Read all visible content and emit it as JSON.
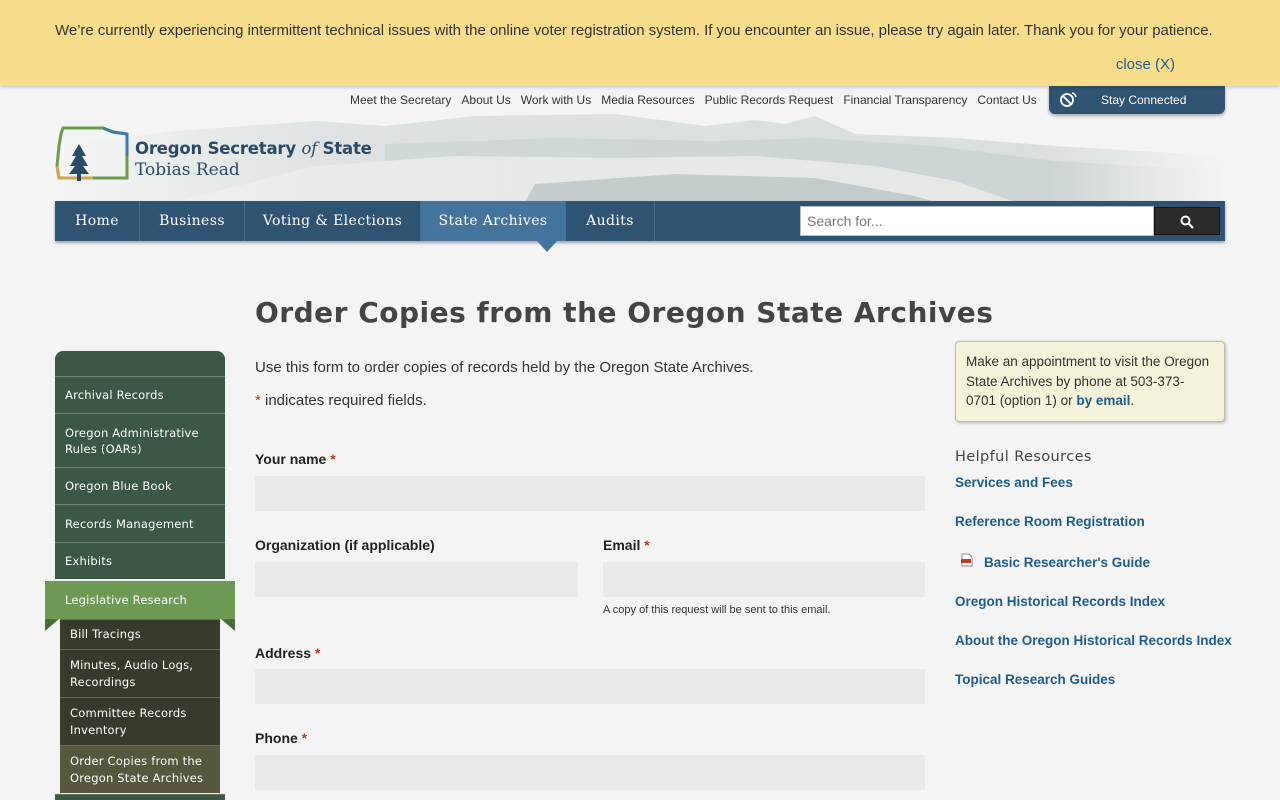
{
  "alert": {
    "message": "We’re currently experiencing intermittent technical issues with the online voter registration system. If you encounter an issue, please try again later. Thank you for your patience.",
    "close_label": "close (X)"
  },
  "utility_nav": [
    "Meet the Secretary",
    "About Us",
    "Work with Us",
    "Media Resources",
    "Public Records Request",
    "Financial Transparency",
    "Contact Us"
  ],
  "stay_connected": "Stay Connected",
  "logo": {
    "title_part1": "Oregon Secretary ",
    "title_of": "of",
    "title_part2": " State",
    "subtitle": "Tobias Read"
  },
  "main_nav": {
    "items": [
      "Home",
      "Business",
      "Voting & Elections",
      "State Archives",
      "Audits"
    ],
    "active": "State Archives"
  },
  "search": {
    "placeholder": "Search for..."
  },
  "sidebar": {
    "items": [
      "Archival Records",
      "Oregon Administrative Rules (OARs)",
      "Oregon Blue Book",
      "Records Management",
      "Exhibits"
    ],
    "active": "Legislative Research",
    "subitems": [
      "Bill Tracings",
      "Minutes, Audio Logs, Recordings",
      "Committee Records Inventory",
      "Order Copies from the Oregon State Archives"
    ]
  },
  "page": {
    "title": "Order Copies from the Oregon State Archives",
    "intro": "Use this form to order copies of records held by the Oregon State Archives.",
    "required_star": "*",
    "required_note": " indicates required fields."
  },
  "form": {
    "name_label": "Your name",
    "org_label": "Organization (if applicable)",
    "email_label": "Email",
    "email_help": "A copy of this request will be sent to this email.",
    "address_label": "Address",
    "phone_label": "Phone"
  },
  "callout": {
    "text": "Make an appointment to visit the Oregon State Archives by phone at 503-373-0701 (option 1) or ",
    "link": "by email",
    "end": "."
  },
  "resources": {
    "title": "Helpful Resources",
    "links": [
      "Services and Fees",
      "Reference Room Registration",
      "Basic Researcher's Guide",
      "Oregon Historical Records Index",
      "About the Oregon Historical Records Index",
      "Topical Research Guides"
    ]
  },
  "colors": {
    "nav": "#2e5373",
    "nav_active": "#44749c",
    "sidebar": "#3b5847",
    "sidebar_active": "#6e9a55",
    "alert": "#f8dd8d",
    "link": "#1f5c8b"
  }
}
